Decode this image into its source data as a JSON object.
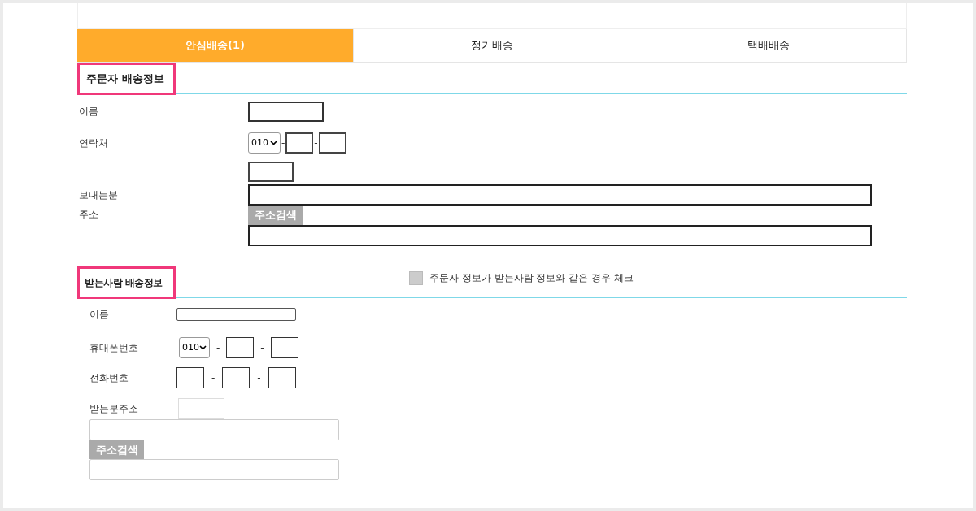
{
  "tabs": [
    {
      "label": "안심배송(1)",
      "selected": true
    },
    {
      "label": "정기배송",
      "selected": false
    },
    {
      "label": "택배배송",
      "selected": false
    }
  ],
  "sender": {
    "title": "주문자 배송정보",
    "name_label": "이름",
    "contact_label": "연락처",
    "contact_prefix": "010",
    "separator": "-",
    "address_label": "보내는분 주소",
    "search_button": "주소검색"
  },
  "recipient": {
    "title": "받는사람 배송정보",
    "same_checkbox": {
      "label": "주문자 정보가 받는사람 정보와 같은 경우 체크",
      "checked": false
    },
    "name_label": "이름",
    "mobile_label": "휴대폰번호",
    "mobile_prefix": "010",
    "phone_label": "전화번호",
    "separator": "-",
    "address_label": "받는분주소",
    "search_button": "주소검색"
  }
}
